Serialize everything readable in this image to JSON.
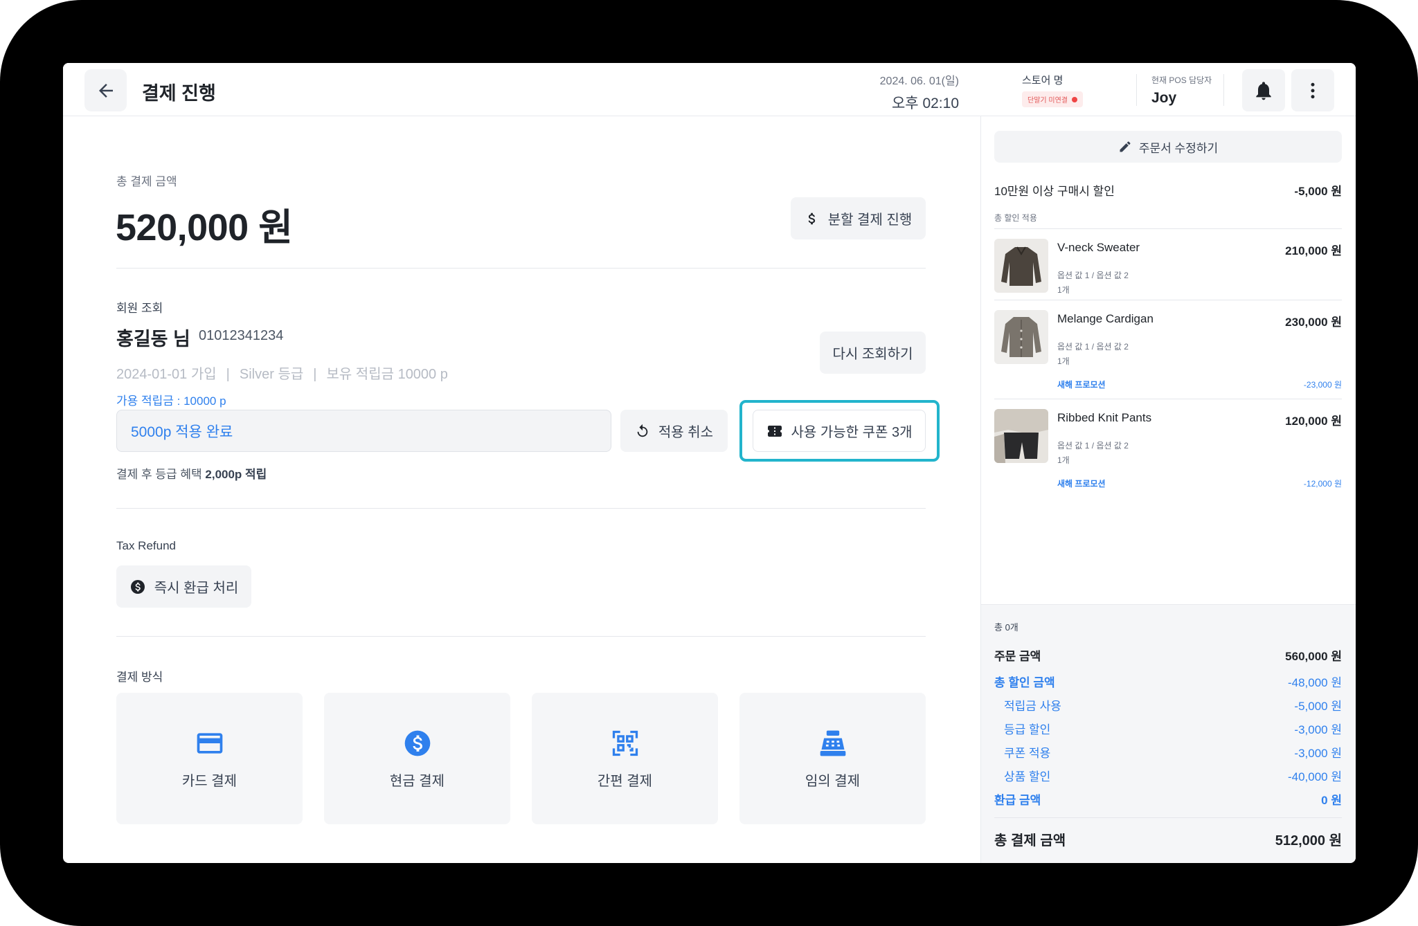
{
  "header": {
    "title": "결제 진행",
    "date": "2024. 06. 01(일)",
    "time": "오후 02:10",
    "store_label": "스토어 명",
    "store_status": "단말기 미연결",
    "staff_label": "현재 POS 담당자",
    "staff_name": "Joy"
  },
  "main": {
    "total_label": "총 결제 금액",
    "total_amount": "520,000 원",
    "split_button": "분할 결제 진행",
    "member": {
      "section_label": "회원 조회",
      "name": "홍길동 님",
      "phone": "01012341234",
      "joined": "2024-01-01 가입",
      "grade": "Silver 등급",
      "points_held": "보유 적립금 10000 p",
      "requery_button": "다시 조회하기",
      "available_points": "가용 적립금 : 10000 p",
      "points_input_value": "5000p 적용 완료",
      "cancel_apply_button": "적용 취소",
      "coupon_button": "사용 가능한 쿠폰 3개",
      "grade_benefit_prefix": "결제 후 등급 혜택",
      "grade_benefit_value": "2,000p 적립"
    },
    "tax_refund": {
      "label": "Tax Refund",
      "button": "즉시 환급 처리"
    },
    "payment": {
      "label": "결제 방식",
      "methods": [
        {
          "label": "카드 결제",
          "icon": "credit-card-icon"
        },
        {
          "label": "현금 결제",
          "icon": "dollar-coin-icon"
        },
        {
          "label": "간편 결제",
          "icon": "qr-code-icon"
        },
        {
          "label": "임의 결제",
          "icon": "cash-register-icon"
        }
      ]
    }
  },
  "order": {
    "edit_button": "주문서 수정하기",
    "promo_name": "10만원 이상 구매시 할인",
    "promo_amount": "-5,000 원",
    "promo_sub": "총 할인 적용",
    "items": [
      {
        "name": "V-neck Sweater",
        "price": "210,000 원",
        "options": "옵션 값 1 / 옵션 값 2",
        "qty": "1개",
        "promo": "",
        "promo_amount": ""
      },
      {
        "name": "Melange Cardigan",
        "price": "230,000 원",
        "options": "옵션 값 1 / 옵션 값 2",
        "qty": "1개",
        "promo": "새해 프로모션",
        "promo_amount": "-23,000 원"
      },
      {
        "name": "Ribbed Knit Pants",
        "price": "120,000 원",
        "options": "옵션 값 1 / 옵션 값 2",
        "qty": "1개",
        "promo": "새해 프로모션",
        "promo_amount": "-12,000 원"
      }
    ]
  },
  "summary": {
    "count": "총 0개",
    "order_amount_label": "주문 금액",
    "order_amount": "560,000 원",
    "discount_label": "총 할인 금액",
    "discount": "-48,000 원",
    "points_label": "적립금 사용",
    "points": "-5,000 원",
    "grade_label": "등급 할인",
    "grade": "-3,000 원",
    "coupon_label": "쿠폰 적용",
    "coupon": "-3,000 원",
    "product_label": "상품 할인",
    "product": "-40,000 원",
    "refund_label": "환급 금액",
    "refund": "0 원",
    "total_label": "총 결제 금액",
    "total": "512,000 원"
  },
  "colors": {
    "accent": "#2f80ed",
    "highlight": "#22b4cc",
    "alert": "#ef4444"
  }
}
